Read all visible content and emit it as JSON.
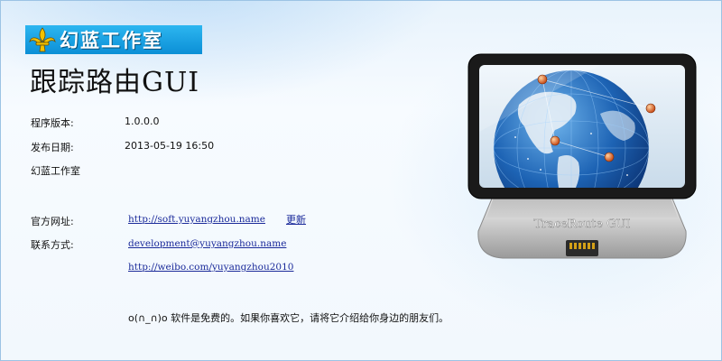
{
  "logo": {
    "text": "幻蓝工作室",
    "icon": "fleur-de-lis-icon"
  },
  "title": "跟踪路由GUI",
  "info": {
    "version_label": "程序版本:",
    "version_value": "1.0.0.0",
    "date_label": "发布日期:",
    "date_value": "2013-05-19 16:50",
    "studio": "幻蓝工作室"
  },
  "contact": {
    "website_label": "官方网址:",
    "website_url": "http://soft.yuyangzhou.name",
    "update_label": "更新",
    "contact_label": "联系方式:",
    "email": "development@yuyangzhou.name",
    "weibo": "http://weibo.com/yuyangzhou2010"
  },
  "note": "o(∩_∩)o 软件是免费的。如果你喜欢它，请将它介绍给你身边的朋友们。",
  "device": {
    "label": "TraceRoute GUI",
    "icon": "globe-router-icon"
  },
  "colors": {
    "logo_bg": "#0b8fd6",
    "link": "#1a2a9a",
    "background": "#e8f3fc"
  }
}
